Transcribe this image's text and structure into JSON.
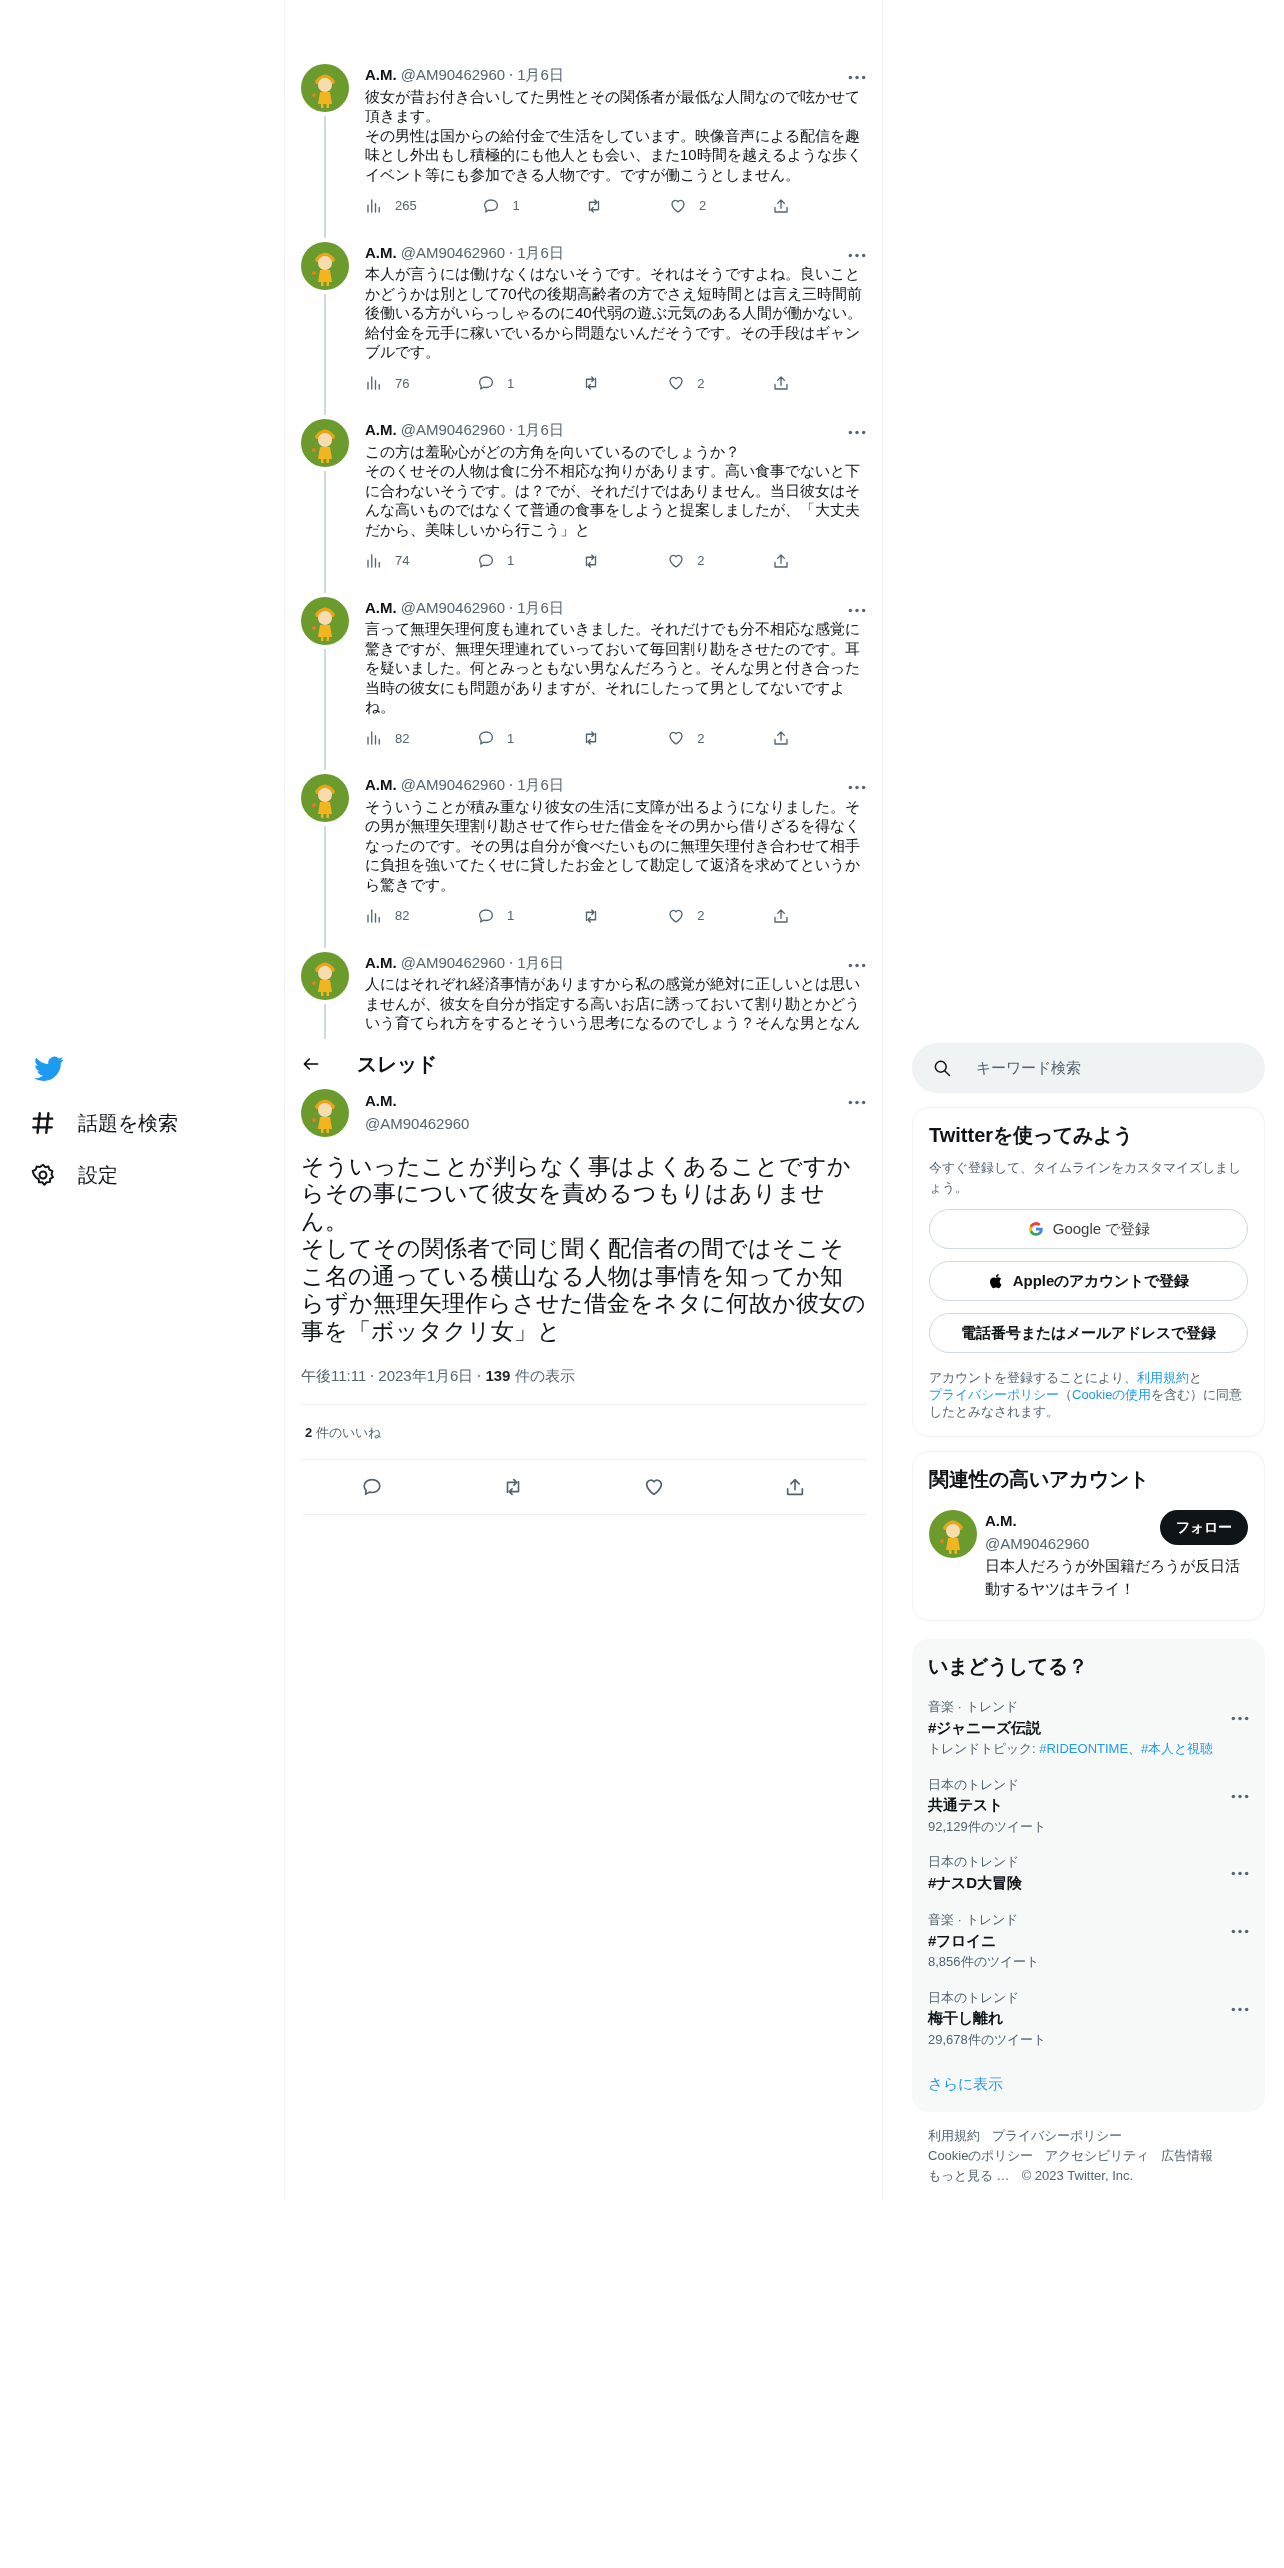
{
  "nav": {
    "items": [
      {
        "kind": "explore",
        "label": "話題を検索"
      },
      {
        "kind": "settings",
        "label": "設定"
      }
    ]
  },
  "thread": {
    "tweets": [
      {
        "name": "A.M.",
        "handle": "@AM90462960",
        "date": "1月6日",
        "paragraphs": [
          "彼女が昔お付き合いしてた男性とその関係者が最低な人間なので呟かせて頂きます。",
          "その男性は国からの給付金で生活をしています。映像音声による配信を趣味とし外出もし積極的にも他人とも会い、また10時間を越えるような歩くイベント等にも参加できる人物です。ですが働こうとしません。"
        ],
        "views": "265",
        "replies": "1",
        "likes": "2"
      },
      {
        "name": "A.M.",
        "handle": "@AM90462960",
        "date": "1月6日",
        "paragraphs": [
          "本人が言うには働けなくはないそうです。それはそうですよね。良いことかどうかは別として70代の後期高齢者の方でさえ短時間とは言え三時間前後働いる方がいらっしゃるのに40代弱の遊ぶ元気のある人間が働かない。給付金を元手に稼いでいるから問題ないんだそうです。その手段はギャンブルです。"
        ],
        "views": "76",
        "replies": "1",
        "likes": "2"
      },
      {
        "name": "A.M.",
        "handle": "@AM90462960",
        "date": "1月6日",
        "paragraphs": [
          "この方は羞恥心がどの方角を向いているのでしょうか？",
          "そのくせその人物は食に分不相応な拘りがあります。高い食事でないと下に合わないそうです。は？でが、それだけではありません。当日彼女はそんな高いものではなくて普通の食事をしようと提案しましたが、「大丈夫だから、美味しいから行こう」と"
        ],
        "views": "74",
        "replies": "1",
        "likes": "2"
      },
      {
        "name": "A.M.",
        "handle": "@AM90462960",
        "date": "1月6日",
        "paragraphs": [
          "言って無理矢理何度も連れていきました。それだけでも分不相応な感覚に驚きですが、無理矢理連れていっておいて毎回割り勘をさせたのです。耳を疑いました。何とみっともない男なんだろうと。そんな男と付き合った当時の彼女にも問題がありますが、それにしたって男としてないですよね。"
        ],
        "views": "82",
        "replies": "1",
        "likes": "2"
      },
      {
        "name": "A.M.",
        "handle": "@AM90462960",
        "date": "1月6日",
        "paragraphs": [
          "そういうことが積み重なり彼女の生活に支障が出るようになりました。その男が無理矢理割り勘させて作らせた借金をその男から借りざるを得なくなったのです。その男は自分が食べたいものに無理矢理付き合わせて相手に負担を強いてたくせに貸したお金として勘定して返済を求めてというから驚きです。"
        ],
        "views": "82",
        "replies": "1",
        "likes": "2"
      },
      {
        "name": "A.M.",
        "handle": "@AM90462960",
        "date": "1月6日",
        "paragraphs": [
          "人にはそれぞれ経済事情がありますから私の感覚が絶対に正しいとは思いませんが、彼女を自分が指定する高いお店に誘っておいて割り勘とかどういう育てられ方をするとそういう思考になるのでしょう？そんな男となん"
        ]
      }
    ],
    "header": {
      "title": "スレッド"
    },
    "main": {
      "name": "A.M.",
      "handle": "@AM90462960",
      "paragraphs": [
        "そういったことが判らなく事はよくあることですからその事について彼女を責めるつもりはありません。",
        "そしてその関係者で同じ聞く配信者の間ではそこそこ名の通っている横山なる人物は事情を知ってか知らずか無理矢理作らさせた借金をネタに何故か彼女の事を「ボッタクリ女」と"
      ],
      "time": "午後11:11",
      "date": "2023年1月6日",
      "views_count": "139",
      "views_label": "件の表示",
      "likes_count": "2",
      "likes_label": "件のいいね"
    }
  },
  "sidebar": {
    "search": {
      "placeholder": "キーワード検索"
    },
    "signup": {
      "title": "Twitterを使ってみよう",
      "subtitle": "今すぐ登録して、タイムラインをカスタマイズしましょう。",
      "buttons": [
        {
          "kind": "google",
          "label": "Google で登録"
        },
        {
          "kind": "apple",
          "label": "Appleのアカウントで登録"
        },
        {
          "kind": "phone",
          "label": "電話番号またはメールアドレスで登録"
        }
      ],
      "legal": [
        {
          "text": "アカウントを登録することにより、",
          "link": false
        },
        {
          "text": "利用規約",
          "link": true
        },
        {
          "text": "と",
          "link": false
        },
        {
          "text": "プライバシーポリシー",
          "link": true
        },
        {
          "text": "（",
          "link": false
        },
        {
          "text": "Cookieの使用",
          "link": true
        },
        {
          "text": "を含む）に同意したとみなされます。",
          "link": false
        }
      ]
    },
    "related": {
      "title": "関連性の高いアカウント",
      "accounts": [
        {
          "name": "A.M.",
          "handle": "@AM90462960",
          "bio": "日本人だろうが外国籍だろうが反日活動するヤツはキライ！",
          "button": "フォロー"
        }
      ]
    },
    "trends": {
      "title": "いまどうしてる？",
      "items": [
        {
          "context": "音楽 · トレンド",
          "name": "#ジャニーズ伝説",
          "topics": [
            {
              "text": "トレンドトピック: ",
              "link": false
            },
            {
              "text": "#RIDEONTIME",
              "link": true
            },
            {
              "text": "、",
              "link": false
            },
            {
              "text": "#本人と視聴",
              "link": true
            }
          ]
        },
        {
          "context": "日本のトレンド",
          "name": "共通テスト",
          "count": "92,129件のツイート"
        },
        {
          "context": "日本のトレンド",
          "name": "#ナスD大冒険"
        },
        {
          "context": "音楽 · トレンド",
          "name": "#フロイニ",
          "count": "8,856件のツイート"
        },
        {
          "context": "日本のトレンド",
          "name": "梅干し離れ",
          "count": "29,678件のツイート"
        }
      ],
      "more": "さらに表示"
    },
    "footer": {
      "links": [
        "利用規約",
        "プライバシーポリシー",
        "Cookieのポリシー",
        "アクセシビリティ",
        "広告情報",
        "もっと見る …",
        "© 2023 Twitter, Inc."
      ]
    }
  }
}
